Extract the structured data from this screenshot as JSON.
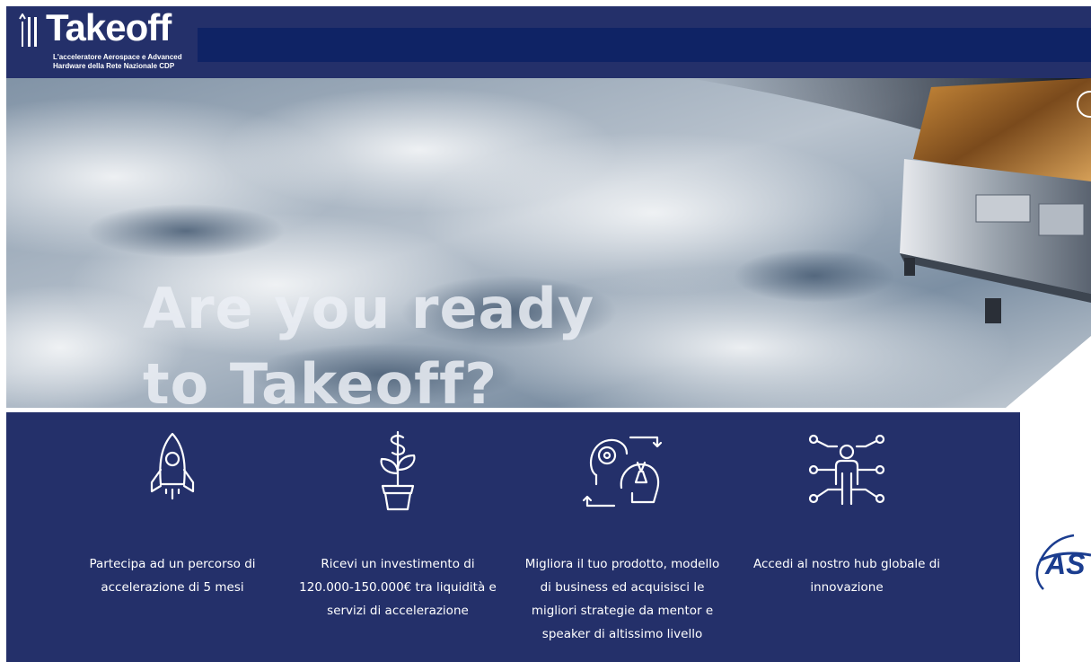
{
  "header": {
    "logo_text": "Takeoff",
    "logo_subtitle_line1": "L'acceleratore Aerospace e Advanced",
    "logo_subtitle_line2": "Hardware della Rete Nazionale CDP"
  },
  "hero": {
    "title_line1": "Are you ready",
    "title_line2": "to Takeoff?"
  },
  "features": [
    {
      "icon": "rocket-icon",
      "text": "Partecipa ad un percorso di accelerazione di 5 mesi"
    },
    {
      "icon": "money-plant-icon",
      "text": "Ricevi un investimento di 120.000-150.000€ tra liquidità e servizi di accelerazione"
    },
    {
      "icon": "growth-mindset-icon",
      "text": "Migliora il tuo prodotto, modello di business ed acquisisci le migliori strategie da mentor e speaker di altissimo livello"
    },
    {
      "icon": "network-hub-icon",
      "text": "Accedi al nostro hub globale di innovazione"
    }
  ],
  "partner": {
    "text": "AS"
  },
  "colors": {
    "header_bg": "#24306a",
    "navbar_bg": "#0f2365",
    "features_bg": "#24306a",
    "partner_blue": "#1b3d8f"
  }
}
